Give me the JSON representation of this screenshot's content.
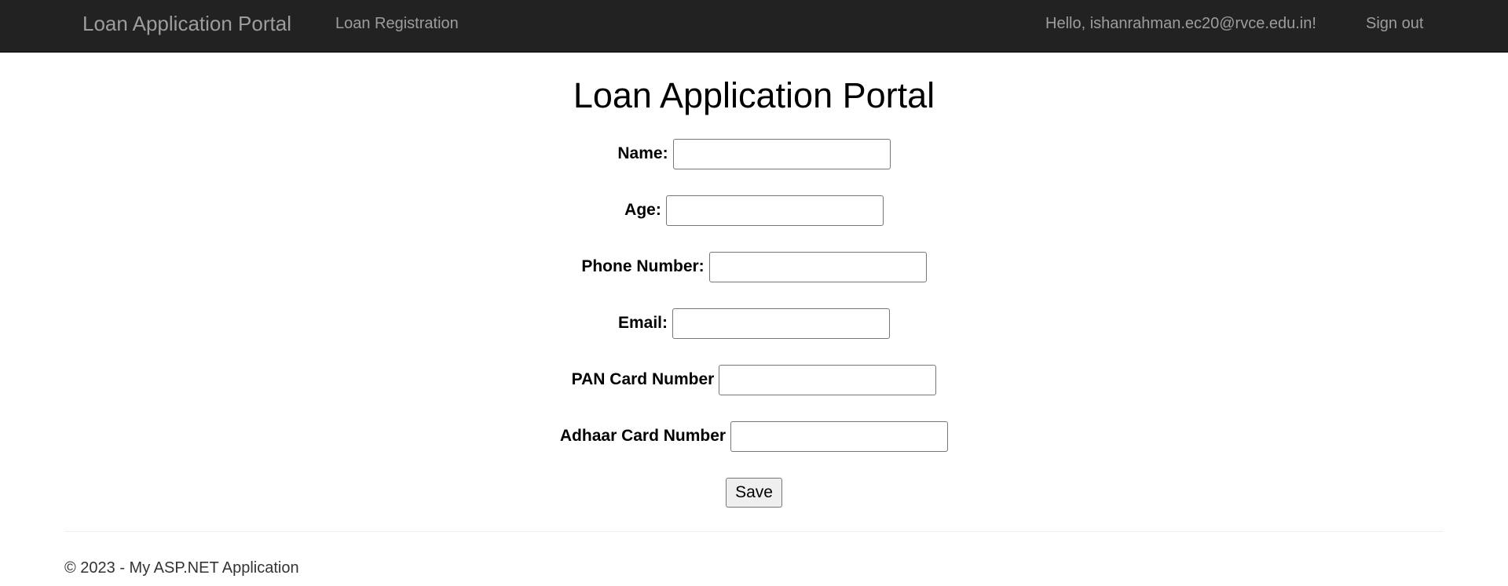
{
  "navbar": {
    "brand": "Loan Application Portal",
    "register_link": "Loan Registration",
    "greeting": "Hello, ishanrahman.ec20@rvce.edu.in!",
    "signout": "Sign out",
    "background_color": "#222222",
    "link_color": "#9d9d9d"
  },
  "main": {
    "title": "Loan Application Portal",
    "fields": [
      {
        "label": "Name:",
        "value": ""
      },
      {
        "label": "Age:",
        "value": ""
      },
      {
        "label": "Phone Number:",
        "value": ""
      },
      {
        "label": "Email:",
        "value": ""
      },
      {
        "label": "PAN Card Number",
        "value": ""
      },
      {
        "label": "Adhaar Card Number",
        "value": ""
      }
    ],
    "save_label": "Save"
  },
  "footer": {
    "text": "© 2023 - My ASP.NET Application"
  }
}
